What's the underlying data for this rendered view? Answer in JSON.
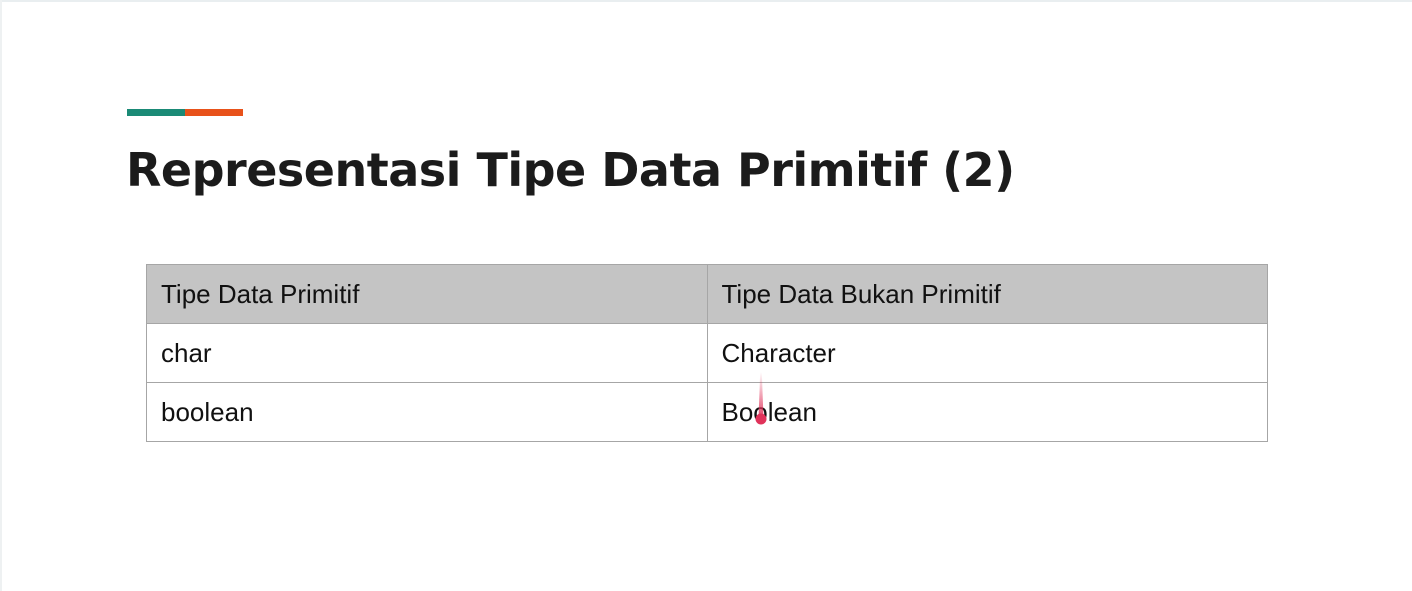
{
  "slide": {
    "title": "Representasi Tipe Data Primitif (2)",
    "accent_colors": [
      "#1a8a76",
      "#e8521a"
    ]
  },
  "table": {
    "headers": [
      "Tipe Data Primitif",
      "Tipe Data Bukan Primitif"
    ],
    "rows": [
      [
        "char",
        "Character"
      ],
      [
        "boolean",
        "Boolean"
      ]
    ]
  },
  "pointer": {
    "icon": "laser-pointer-icon",
    "color": "#e0325a"
  }
}
